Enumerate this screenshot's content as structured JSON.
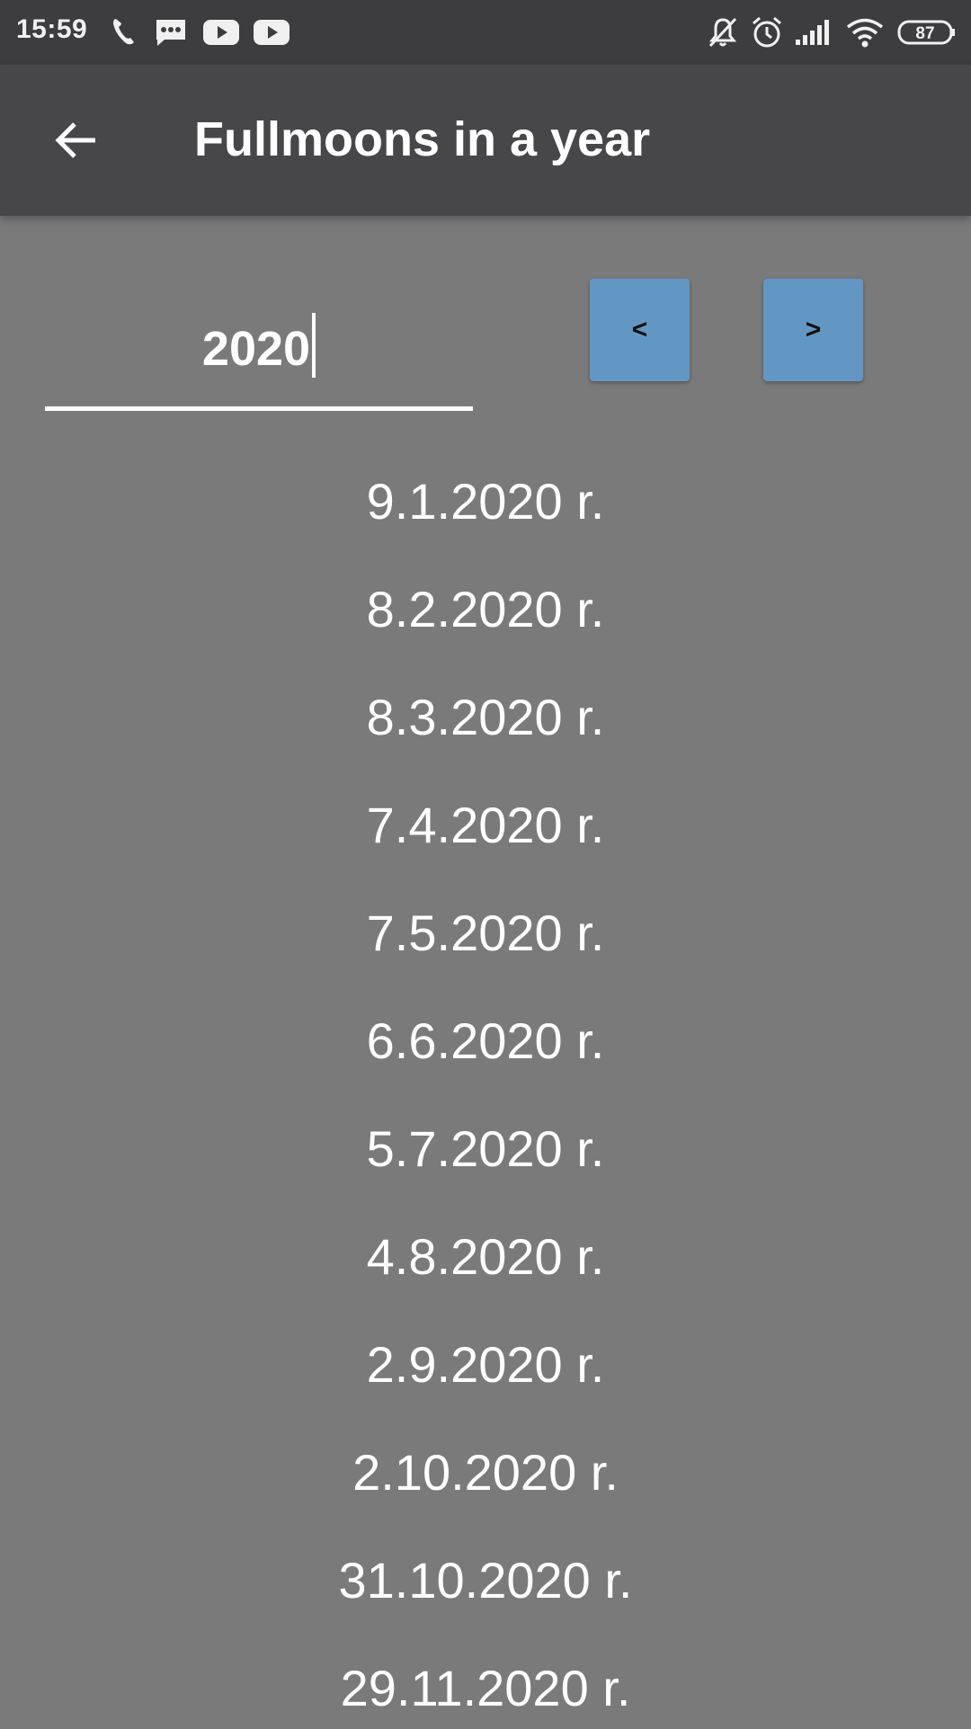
{
  "status_bar": {
    "time": "15:59",
    "battery": "87",
    "icons": [
      "missed-call-icon",
      "message-icon",
      "youtube-icon",
      "youtube-icon",
      "bell-off-icon",
      "alarm-icon",
      "signal-icon",
      "wifi-icon",
      "battery-icon"
    ]
  },
  "app_bar": {
    "title": "Fullmoons in a year",
    "back_icon": "arrow-left-icon"
  },
  "year_input": {
    "value": "2020"
  },
  "nav": {
    "prev_label": "<",
    "next_label": ">",
    "button_color": "#6397c3"
  },
  "dates": [
    "9.1.2020 r.",
    "8.2.2020 r.",
    "8.3.2020 r.",
    "7.4.2020 r.",
    "7.5.2020 r.",
    "6.6.2020 r.",
    "5.7.2020 r.",
    "4.8.2020 r.",
    "2.9.2020 r.",
    "2.10.2020 r.",
    "31.10.2020 r.",
    "29.11.2020 r."
  ],
  "colors": {
    "background": "#7a7a7a",
    "status_bar": "#3d3d3f",
    "app_bar": "#474749",
    "text": "#ffffff"
  }
}
